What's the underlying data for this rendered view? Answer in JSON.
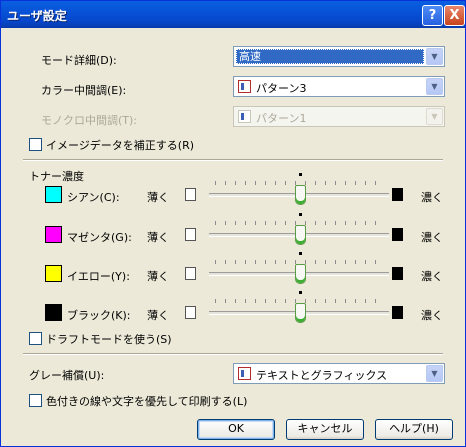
{
  "window": {
    "title": "ユーザ設定",
    "help_button": "?",
    "close_button": "X"
  },
  "mode_detail": {
    "label": "モード詳細(D):",
    "value": "高速"
  },
  "color_halftone": {
    "label": "カラー中間調(E):",
    "value": "パターン3"
  },
  "mono_halftone": {
    "label": "モノクロ中間調(T):",
    "value": "パターン1"
  },
  "image_correct": {
    "label": "イメージデータを補正する(R)",
    "checked": false
  },
  "toner_density": {
    "label": "トナー濃度",
    "light_label": "薄く",
    "dark_label": "濃く",
    "channels": [
      {
        "name": "シアン(C):",
        "color": "#00ffff",
        "level": 0.5
      },
      {
        "name": "マゼンタ(G):",
        "color": "#ff00ff",
        "level": 0.5
      },
      {
        "name": "イエロー(Y):",
        "color": "#ffff00",
        "level": 0.5
      },
      {
        "name": "ブラック(K):",
        "color": "#000000",
        "level": 0.5
      }
    ]
  },
  "draft_mode": {
    "label": "ドラフトモードを使う(S)",
    "checked": false
  },
  "gray_compensation": {
    "label": "グレー補償(U):",
    "value": "テキストとグラフィックス"
  },
  "color_priority": {
    "label": "色付きの線や文字を優先して印刷する(L)",
    "checked": false
  },
  "buttons": {
    "ok": "OK",
    "cancel": "キャンセル",
    "help": "ヘルプ(H)"
  }
}
